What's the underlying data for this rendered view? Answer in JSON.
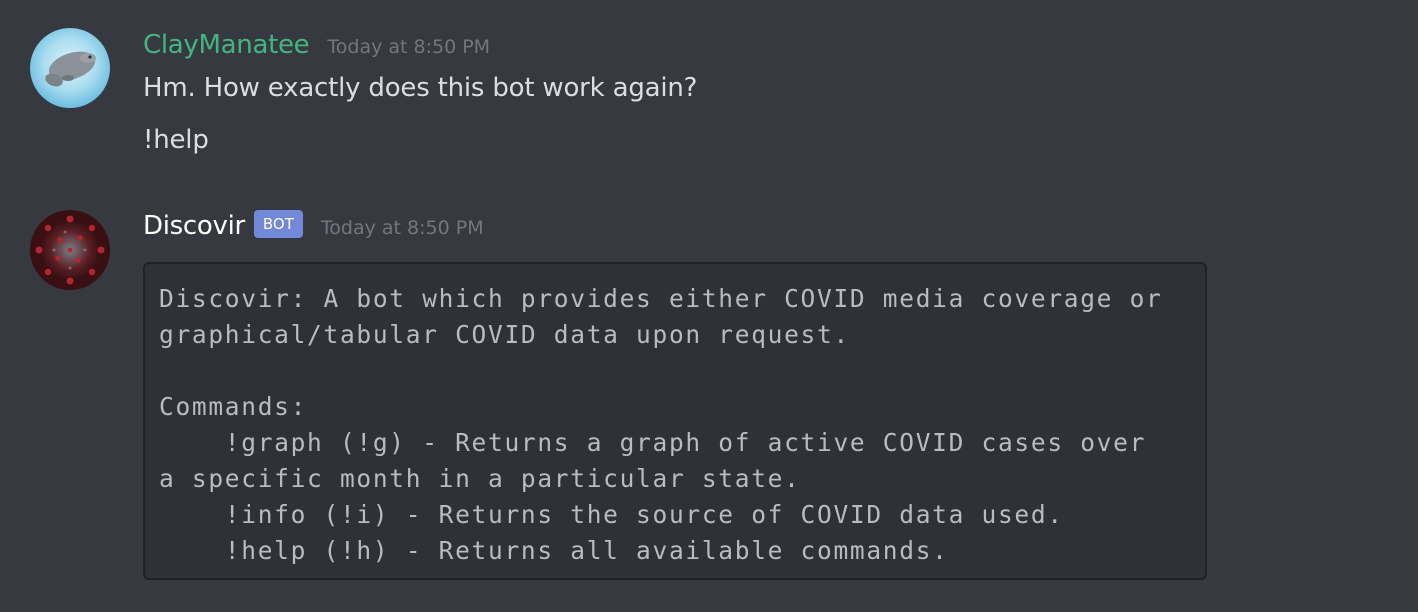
{
  "messages": [
    {
      "author": "ClayManatee",
      "author_color": "#43b581",
      "timestamp": "Today at 8:50 PM",
      "avatar_icon": "manatee-avatar",
      "lines": [
        "Hm. How exactly does this bot work again?",
        "!help"
      ]
    },
    {
      "author": "Discovir",
      "author_color": "#ffffff",
      "badge": "BOT",
      "timestamp": "Today at 8:50 PM",
      "avatar_icon": "coronavirus-avatar",
      "code_block": "Discovir: A bot which provides either COVID media coverage or\ngraphical/tabular COVID data upon request.\n\nCommands:\n    !graph (!g) - Returns a graph of active COVID cases over\na specific month in a particular state.\n    !info (!i) - Returns the source of COVID data used.\n    !help (!h) - Returns all available commands."
    }
  ],
  "colors": {
    "background": "#36393f",
    "code_background": "#2f3136",
    "timestamp": "#72767d",
    "badge": "#7289da",
    "text": "#dcddde"
  }
}
